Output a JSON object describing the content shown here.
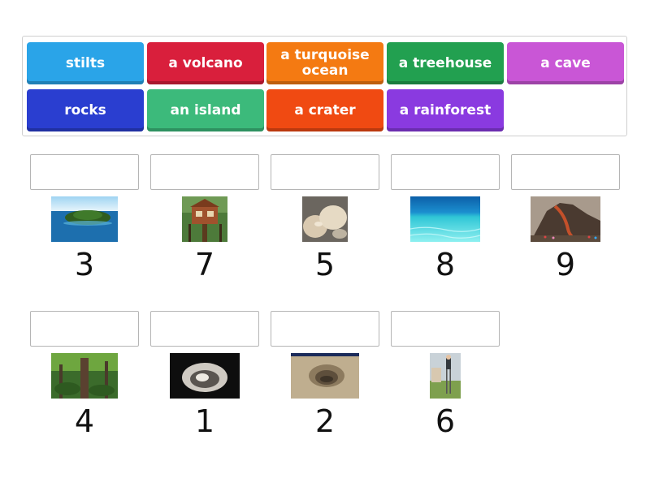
{
  "word_bank": [
    {
      "label": "stilts",
      "color": "#2aa4e8"
    },
    {
      "label": "a volcano",
      "color": "#d91f3c"
    },
    {
      "label": "a turquoise ocean",
      "color": "#f47a12"
    },
    {
      "label": "a treehouse",
      "color": "#22a050"
    },
    {
      "label": "a cave",
      "color": "#c956d6"
    },
    {
      "label": "rocks",
      "color": "#2a3ed0"
    },
    {
      "label": "an island",
      "color": "#3cba7b"
    },
    {
      "label": "a crater",
      "color": "#f04a12"
    },
    {
      "label": "a rainforest",
      "color": "#8a3ae0"
    }
  ],
  "targets": [
    {
      "number": "3",
      "image": "island-image"
    },
    {
      "number": "7",
      "image": "treehouse-image"
    },
    {
      "number": "5",
      "image": "rocks-image"
    },
    {
      "number": "8",
      "image": "turquoise-ocean-image"
    },
    {
      "number": "9",
      "image": "volcano-image"
    },
    {
      "number": "4",
      "image": "rainforest-image"
    },
    {
      "number": "1",
      "image": "cave-image"
    },
    {
      "number": "2",
      "image": "crater-image"
    },
    {
      "number": "6",
      "image": "stilts-image"
    }
  ]
}
